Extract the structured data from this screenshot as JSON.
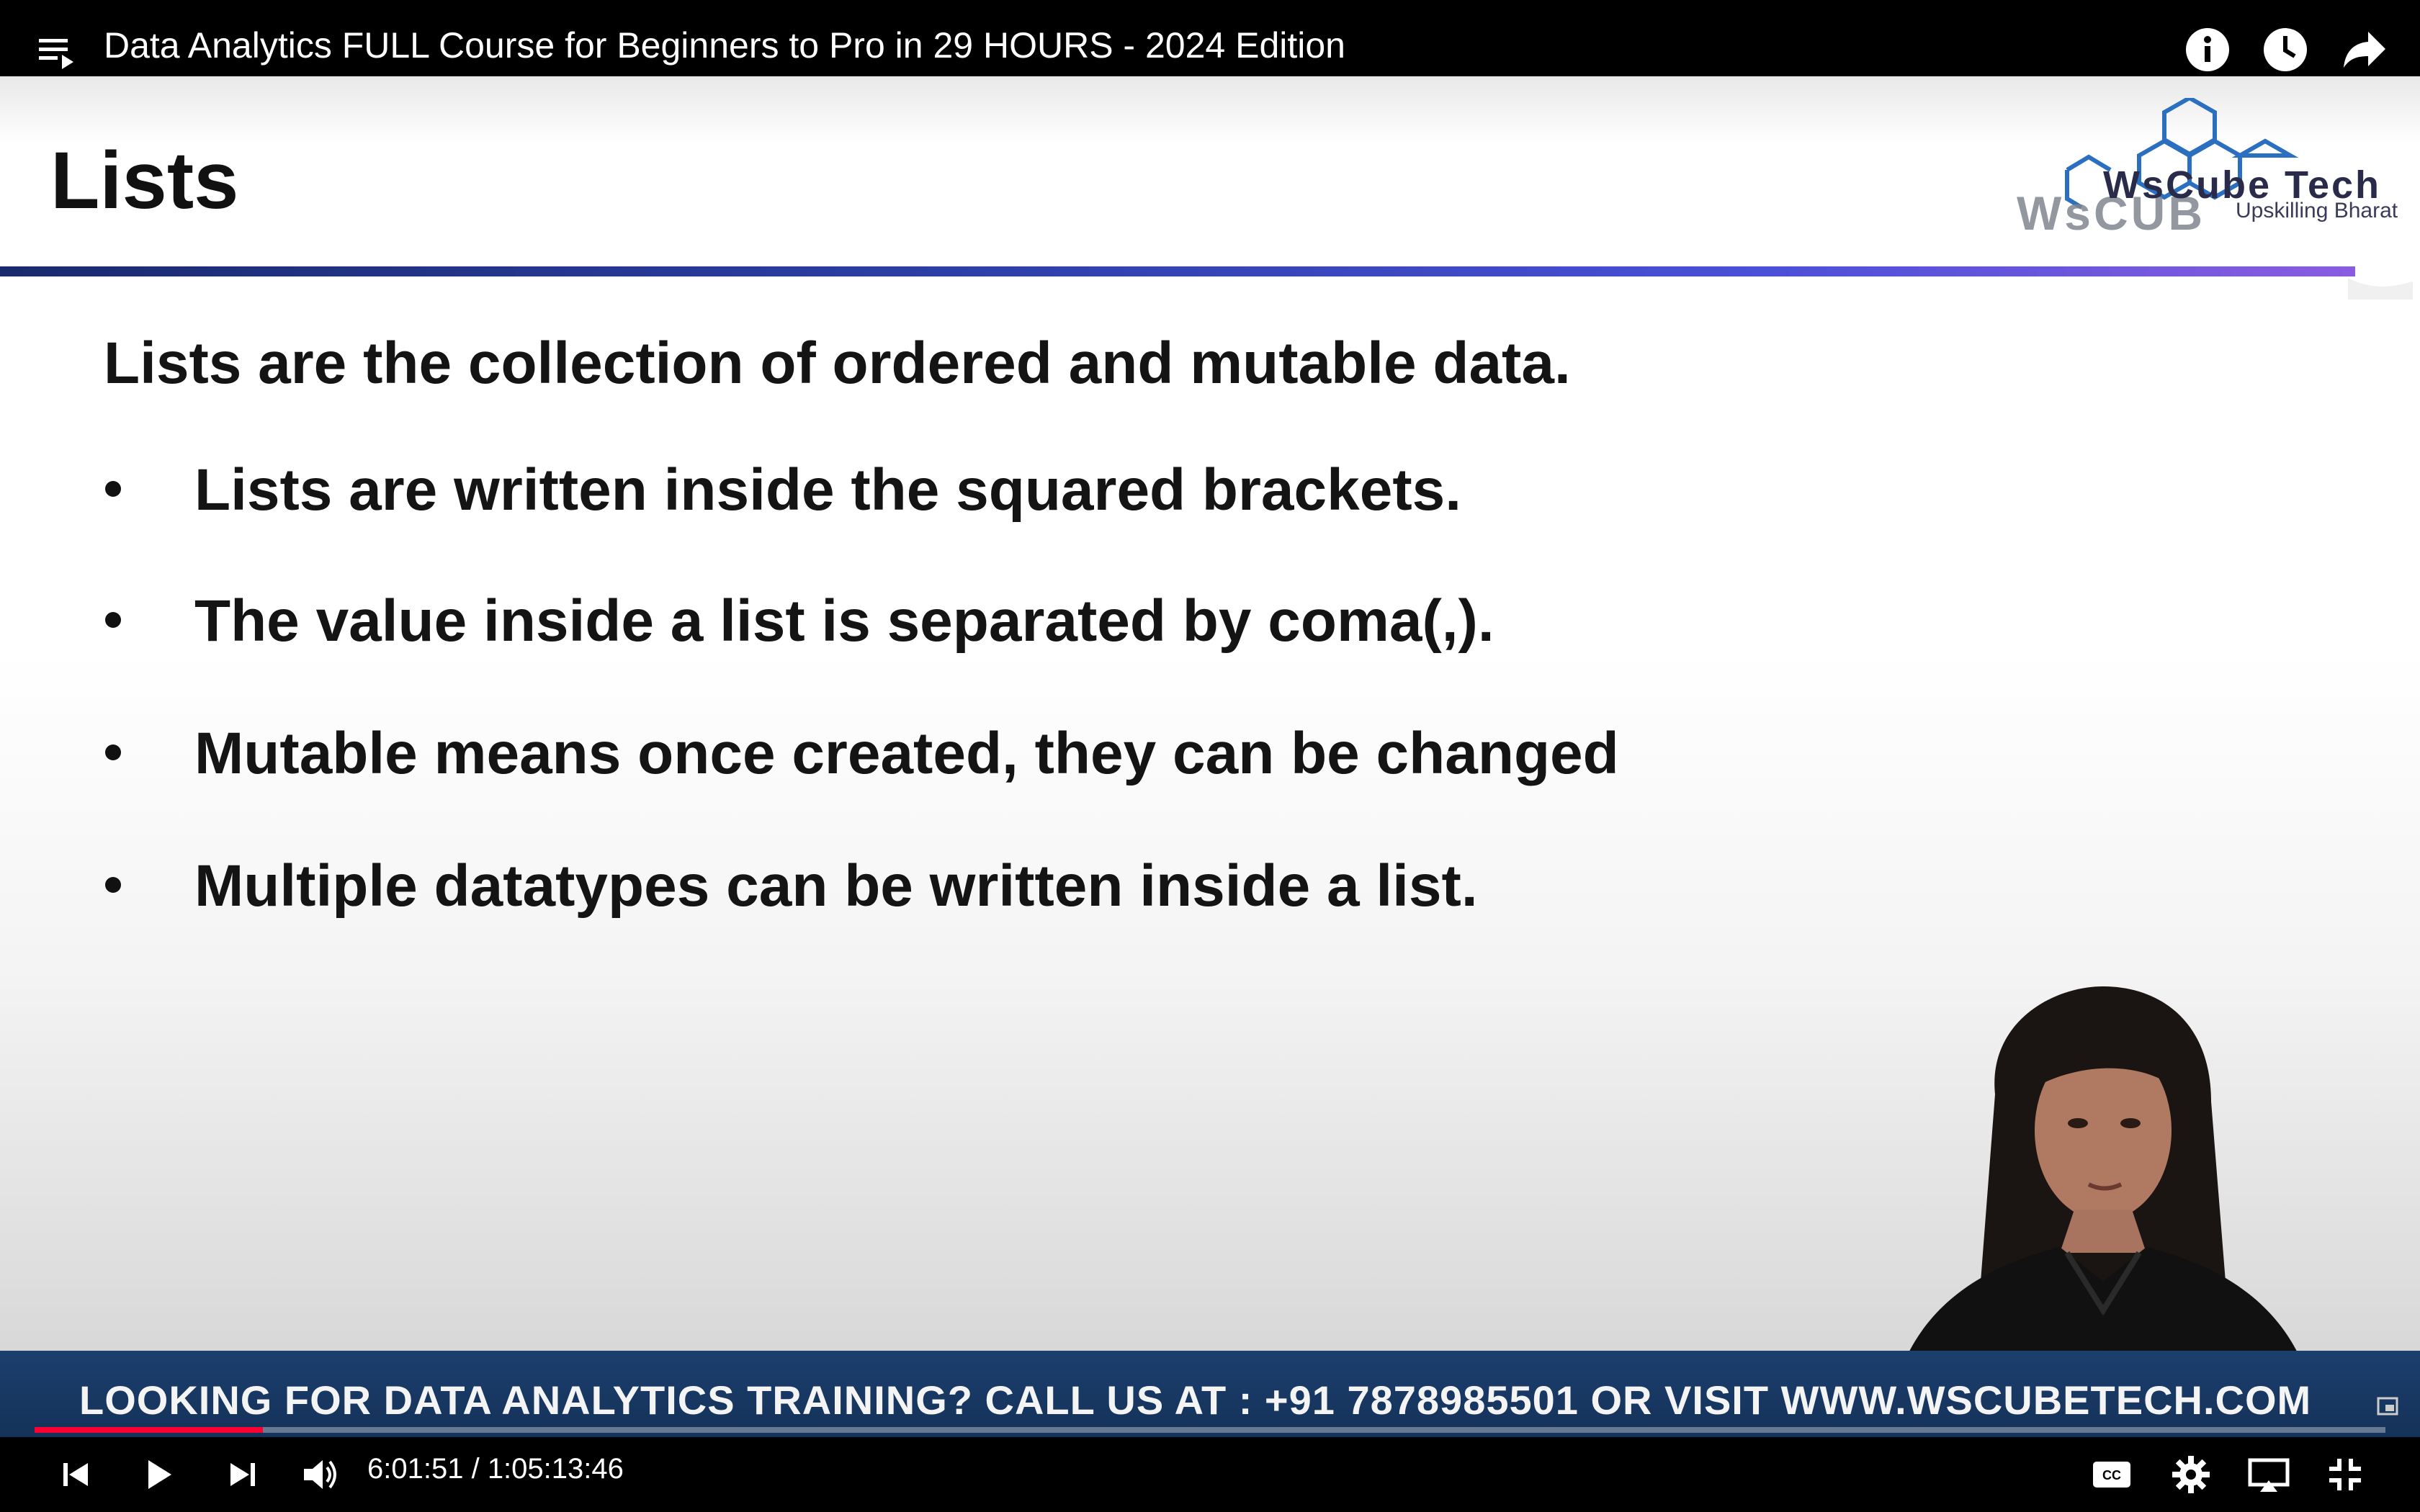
{
  "player": {
    "title": "Data Analytics FULL Course for Beginners to Pro in 29 HOURS - 2024 Edition",
    "current_time": "6:01:51",
    "duration": "1:05:13:46",
    "time_separator": " / ",
    "progress_fraction": 0.097,
    "accent_color": "#ff0033",
    "icons": [
      "playlist-icon",
      "info-icon",
      "watch-later-icon",
      "share-icon",
      "previous-icon",
      "play-icon",
      "next-icon",
      "volume-icon",
      "captions-icon",
      "settings-icon",
      "cast-icon",
      "exit-fullscreen-icon"
    ]
  },
  "slide": {
    "title": "Lists",
    "lead": "Lists are the collection of ordered and mutable data.",
    "bullets": [
      "Lists are written inside the squared brackets.",
      "The value inside a list is separated by coma(,).",
      "Mutable means once created, they can be changed",
      "Multiple datatypes can be written inside a list."
    ],
    "logo": {
      "name": "WsCube Tech",
      "ghost": "WsCUB",
      "tagline": "Upskilling Bharat"
    }
  },
  "banner": {
    "text": "LOOKING FOR DATA ANALYTICS TRAINING? CALL US AT : +91 7878985501 OR VISIT WWW.WSCUBETECH.COM"
  }
}
